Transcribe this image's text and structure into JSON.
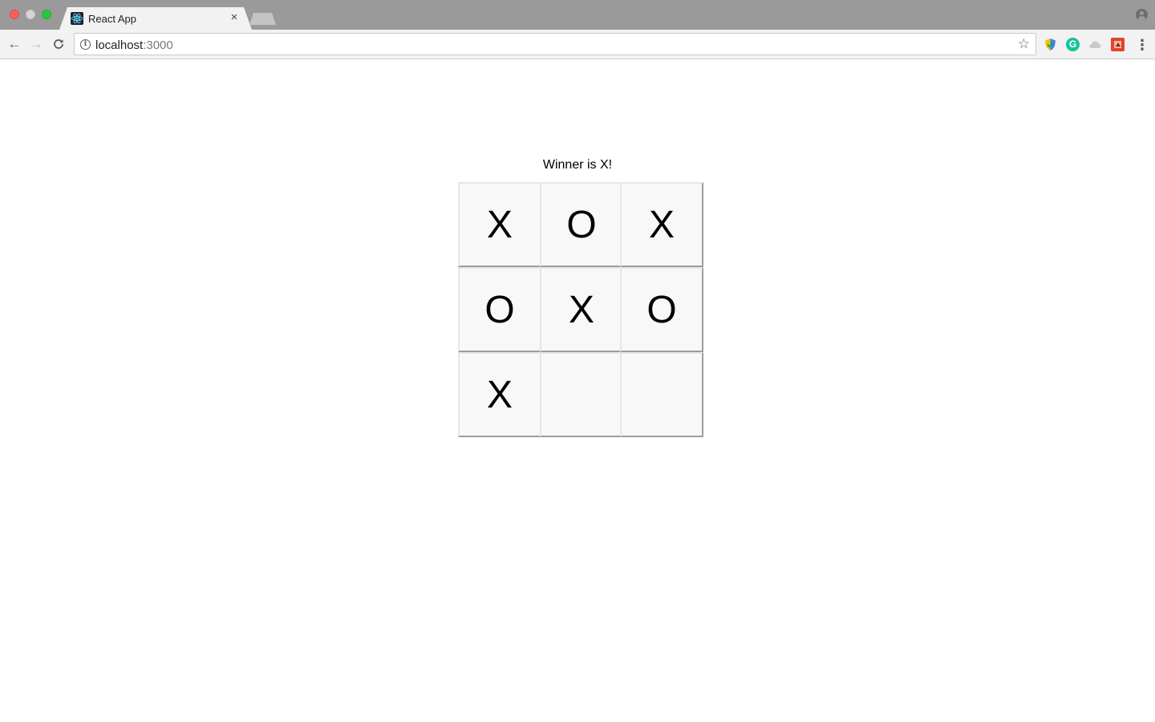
{
  "browser": {
    "tab": {
      "title": "React App",
      "close_glyph": "×",
      "favicon": "react-logo-icon"
    },
    "address": {
      "host": "localhost",
      "port": ":3000"
    },
    "icons": {
      "back": "arrow-left-icon",
      "forward": "arrow-right-icon",
      "reload": "reload-icon",
      "info": "info-icon",
      "bookmark": "star-icon",
      "menu": "kebab-menu-icon",
      "profile": "profile-icon"
    },
    "extensions": [
      {
        "name": "shield-extension-icon"
      },
      {
        "name": "grammarly-extension-icon",
        "letter": "G",
        "color": "#15c39a"
      },
      {
        "name": "cloud-extension-icon"
      },
      {
        "name": "red-extension-icon",
        "color": "#e0442c"
      }
    ]
  },
  "game": {
    "status": "Winner is X!",
    "squares": [
      "X",
      "O",
      "X",
      "O",
      "X",
      "O",
      "X",
      "",
      ""
    ]
  }
}
